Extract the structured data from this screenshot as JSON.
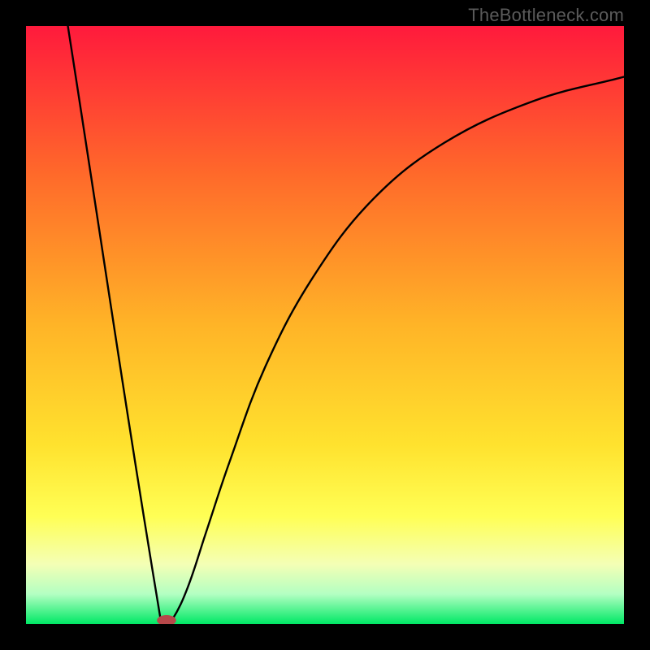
{
  "watermark": "TheBottleneck.com",
  "chart_data": {
    "type": "line",
    "title": "",
    "xlabel": "",
    "ylabel": "",
    "xlim": [
      0,
      100
    ],
    "ylim": [
      0,
      100
    ],
    "background_gradient": {
      "stops": [
        {
          "offset": 0.0,
          "color": "#ff1a3c"
        },
        {
          "offset": 0.25,
          "color": "#ff6a2a"
        },
        {
          "offset": 0.5,
          "color": "#ffb427"
        },
        {
          "offset": 0.7,
          "color": "#ffe22e"
        },
        {
          "offset": 0.82,
          "color": "#ffff55"
        },
        {
          "offset": 0.9,
          "color": "#f4ffb5"
        },
        {
          "offset": 0.95,
          "color": "#b3ffc2"
        },
        {
          "offset": 1.0,
          "color": "#00e865"
        }
      ]
    },
    "curve": {
      "description": "V-shaped curve with asymmetric sides; left branch is a steep straight descent, right branch rises and asymptotically flattens near the top.",
      "points": [
        {
          "x": 7.0,
          "y": 100.0
        },
        {
          "x": 22.5,
          "y": 0.8
        },
        {
          "x": 23.5,
          "y": 0.4
        },
        {
          "x": 24.5,
          "y": 0.8
        },
        {
          "x": 27.0,
          "y": 6.0
        },
        {
          "x": 30.0,
          "y": 15.0
        },
        {
          "x": 34.0,
          "y": 27.0
        },
        {
          "x": 40.0,
          "y": 43.0
        },
        {
          "x": 48.0,
          "y": 58.0
        },
        {
          "x": 58.0,
          "y": 71.0
        },
        {
          "x": 70.0,
          "y": 80.5
        },
        {
          "x": 85.0,
          "y": 87.5
        },
        {
          "x": 100.0,
          "y": 91.5
        }
      ]
    },
    "marker": {
      "x": 23.5,
      "y": 0.6,
      "rx": 1.6,
      "ry": 0.9,
      "color": "#b7484a"
    }
  }
}
